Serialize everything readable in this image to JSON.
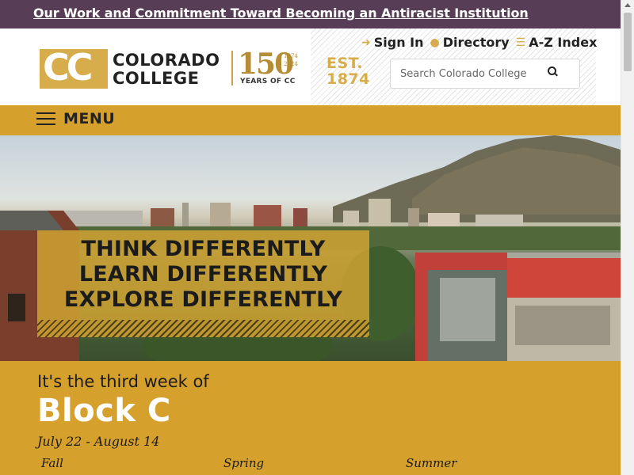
{
  "announcement": {
    "text": "Our Work and Commitment Toward Becoming an Antiracist Institution"
  },
  "logo": {
    "mark": "CC",
    "word1": "COLORADO",
    "word2": "COLLEGE",
    "anniversary_number": "150",
    "anniversary_years_start": "1874",
    "anniversary_years_end": "2024",
    "anniversary_caption": "YEARS OF CC"
  },
  "utility": {
    "links": [
      {
        "label": "Sign In",
        "icon": "sign-in-icon"
      },
      {
        "label": "Directory",
        "icon": "user-icon"
      },
      {
        "label": "A-Z Index",
        "icon": "list-icon"
      }
    ],
    "est_line1": "EST.",
    "est_line2": "1874"
  },
  "search": {
    "placeholder": "Search Colorado College",
    "button_icon": "search-icon"
  },
  "menu": {
    "label": "MENU",
    "icon": "hamburger-icon"
  },
  "hero": {
    "tagline": [
      "THINK DIFFERENTLY",
      "LEARN DIFFERENTLY",
      "EXPLORE DIFFERENTLY"
    ]
  },
  "block_info": {
    "intro": "It's the third week of",
    "name": "Block C",
    "dates": "July 22 - August 14",
    "seasons": [
      "Fall",
      "Spring",
      "Summer"
    ]
  },
  "colors": {
    "announcement_bg": "#573d56",
    "gold": "#d6a02c",
    "logo_gold": "#d6ad4a"
  }
}
